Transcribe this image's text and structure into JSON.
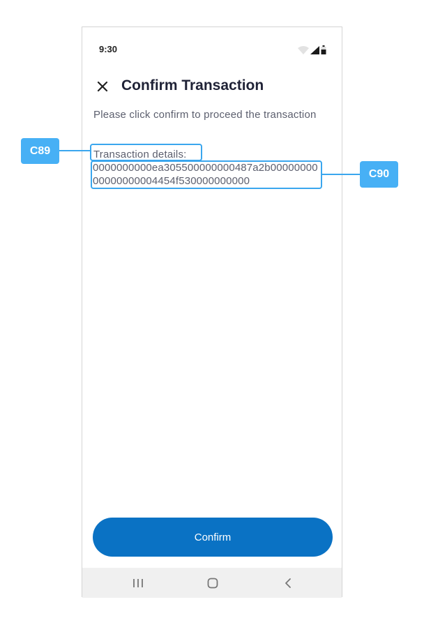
{
  "status_bar": {
    "time": "9:30",
    "icons": [
      "wifi-icon",
      "signal-icon",
      "battery-icon"
    ]
  },
  "header": {
    "close_icon": "close-icon",
    "title": "Confirm Transaction"
  },
  "main": {
    "description": "Please click confirm to proceed the transaction",
    "details_label": "Transaction details:",
    "details_value": "0000000000ea305500000000487a2b0000000000000000004454f530000000000"
  },
  "actions": {
    "confirm_label": "Confirm"
  },
  "nav_bar": {
    "icons": [
      "recent-apps-icon",
      "home-icon",
      "back-icon"
    ]
  },
  "annotations": {
    "tag_a": "C89",
    "tag_b": "C90"
  },
  "colors": {
    "accent": "#0a72c4",
    "annotation": "#47b0f5",
    "title_text": "#1f2236",
    "body_text": "#5c5f6e"
  }
}
